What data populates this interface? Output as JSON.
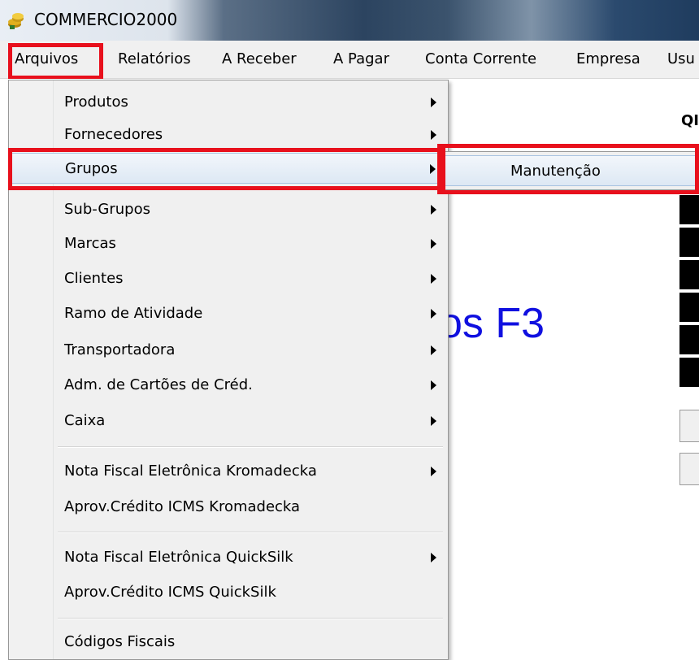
{
  "window": {
    "title": "COMMERCIO2000",
    "icon": "coins-icon"
  },
  "menubar": {
    "items": [
      "Arquivos",
      "Relatórios",
      "A Receber",
      "A Pagar",
      "Conta Corrente",
      "Empresa",
      "Usu"
    ],
    "active": "Arquivos"
  },
  "background": {
    "shortcut_text": "os F3",
    "header_text": "QI"
  },
  "dropdown": {
    "items": [
      {
        "label": "Produtos",
        "submenu": true
      },
      {
        "label": "Fornecedores",
        "submenu": true
      },
      {
        "label": "Grupos",
        "submenu": true,
        "highlighted": true
      },
      {
        "label": "Sub-Grupos",
        "submenu": true
      },
      {
        "label": "Marcas",
        "submenu": true
      },
      {
        "label": "Clientes",
        "submenu": true
      },
      {
        "label": "Ramo de Atividade",
        "submenu": true
      },
      {
        "label": "Transportadora",
        "submenu": true
      },
      {
        "label": "Adm. de Cartões de Créd.",
        "submenu": true
      },
      {
        "label": "Caixa",
        "submenu": true
      },
      {
        "label": "Nota Fiscal Eletrônica Kromadecka",
        "submenu": true
      },
      {
        "label": "Aprov.Crédito ICMS Kromadecka",
        "submenu": false
      },
      {
        "label": "Nota Fiscal Eletrônica QuickSilk",
        "submenu": true
      },
      {
        "label": "Aprov.Crédito ICMS QuickSilk",
        "submenu": false
      },
      {
        "label": "Códigos Fiscais",
        "submenu": false
      }
    ]
  },
  "submenu": {
    "items": [
      {
        "label": "Manutenção"
      }
    ]
  },
  "colors": {
    "highlight_box": "#e8101c",
    "shortcut_text": "#1010e0"
  }
}
